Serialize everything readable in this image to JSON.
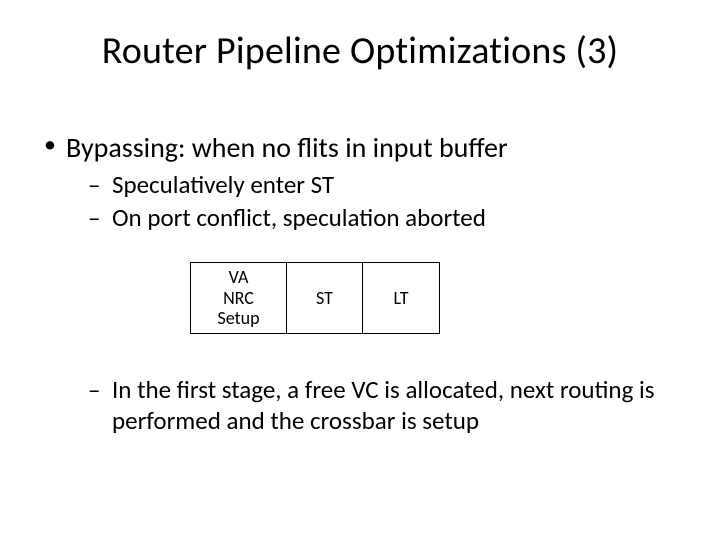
{
  "title": "Router Pipeline Optimizations (3)",
  "bullets": {
    "main": "Bypassing: when no flits in input buffer",
    "sub1": "Speculatively enter ST",
    "sub2": "On port conflict, speculation aborted",
    "sub3": "In the first stage, a free VC is allocated, next routing is performed and the crossbar is setup"
  },
  "pipeline": {
    "stage0": "VA\nNRC\nSetup",
    "stage1": "ST",
    "stage2": "LT"
  }
}
